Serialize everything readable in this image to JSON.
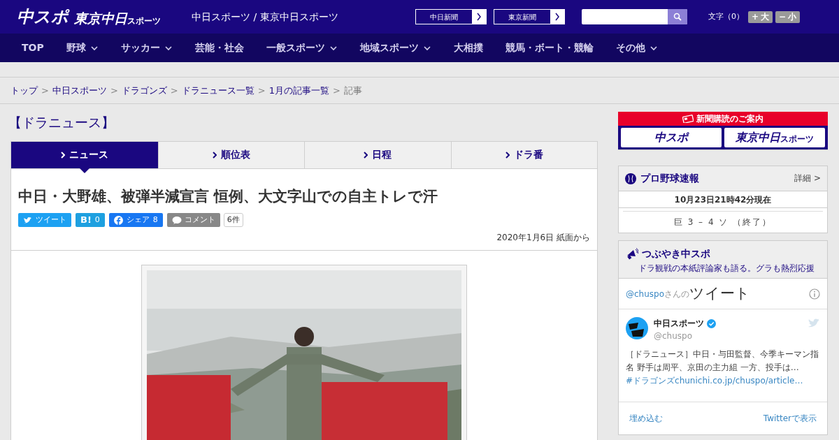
{
  "header": {
    "logo_main": "中スポ",
    "logo_sub_main": "東京中日",
    "logo_sub_small": "スポーツ",
    "site_title": "中日スポーツ / 東京中日スポーツ",
    "partner_links": [
      "中日新聞",
      "東京新聞"
    ],
    "font_size_label": "文字（0）",
    "font_buttons": [
      {
        "sign": "+",
        "label": "大"
      },
      {
        "sign": "−",
        "label": "小"
      }
    ]
  },
  "nav": [
    {
      "label": "TOP",
      "dropdown": false
    },
    {
      "label": "野球",
      "dropdown": true
    },
    {
      "label": "サッカー",
      "dropdown": true
    },
    {
      "label": "芸能・社会",
      "dropdown": false
    },
    {
      "label": "一般スポーツ",
      "dropdown": true
    },
    {
      "label": "地域スポーツ",
      "dropdown": true
    },
    {
      "label": "大相撲",
      "dropdown": false
    },
    {
      "label": "競馬・ボート・競輪",
      "dropdown": false
    },
    {
      "label": "その他",
      "dropdown": true
    }
  ],
  "breadcrumb": [
    {
      "label": "トップ",
      "link": true
    },
    {
      "separator": ">",
      "label": "中日スポーツ",
      "link": true
    },
    {
      "separator": ">",
      "label": "ドラゴンズ",
      "link": true
    },
    {
      "separator": ">",
      "label": "ドラニュース一覧",
      "link": true
    },
    {
      "separator": ">",
      "label": "1月の記事一覧",
      "link": true
    },
    {
      "separator": ">",
      "label": "記事",
      "link": false
    }
  ],
  "section_title": "【ドラニュース】",
  "tabs": [
    {
      "label": "ニュース",
      "selected": true
    },
    {
      "label": "順位表",
      "selected": false
    },
    {
      "label": "日程",
      "selected": false
    },
    {
      "label": "ドラ番",
      "selected": false
    }
  ],
  "article": {
    "headline": "中日・大野雄、被弾半減宣言 恒例、大文字山での自主トレで汗",
    "share": [
      {
        "kind": "twitter",
        "label": "ツイート"
      },
      {
        "kind": "hatena",
        "label": "B!",
        "count": "0"
      },
      {
        "kind": "facebook",
        "label": "シェア",
        "count": "8"
      },
      {
        "kind": "comment",
        "label": "コメント",
        "count": "6件"
      }
    ],
    "dateline": "2020年1月6日 紙面から"
  },
  "sidebar": {
    "subscription": {
      "heading": "新聞購読のご案内",
      "logos": [
        "中スポ",
        "東京中日"
      ],
      "logo_small": "スポーツ"
    },
    "baseball": {
      "title": "プロ野球速報",
      "detail_link": "詳細 >",
      "as_of": "10月23日21時42分現在",
      "score": "巨 3 – 4 ソ （終了）"
    },
    "tweets": {
      "title": "つぶやき中スポ",
      "subtitle": "ドラ観戦の本紙評論家も語る。グラも熱烈応援",
      "handle": "@chuspo",
      "handle_suffix": "さんの",
      "heading": "ツイート",
      "account_name": "中日スポーツ",
      "account_handle": "@chuspo",
      "verified": true,
      "text": "［ドラニュース］中日・与田監督、今季キーマン指名 野手は周平、京田の主力組 一方、投手は…",
      "hashtag": "#ドラゴンズ",
      "link": "chunichi.co.jp/chuspo/article…",
      "footer": [
        "埋め込む",
        "Twitterで表示"
      ]
    }
  }
}
